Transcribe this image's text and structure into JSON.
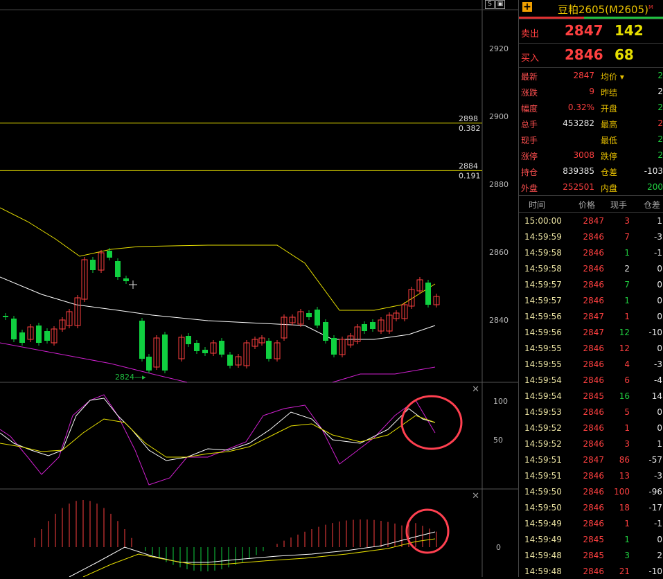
{
  "chart": {
    "toolbar": {
      "s_label": "S",
      "lock_icon": "lock-icon"
    },
    "price_axis": {
      "ticks": [
        "2920",
        "2900",
        "2880",
        "2860",
        "2840"
      ]
    },
    "fib_levels": [
      {
        "price": "2898",
        "ratio": "0.382"
      },
      {
        "price": "2884",
        "ratio": "0.191"
      }
    ],
    "low_annotation": "2824",
    "kdj_axis": {
      "ticks": [
        "100",
        "50"
      ]
    },
    "macd_axis": {
      "ticks": [
        "0"
      ]
    },
    "colors": {
      "up": "#ff4040",
      "down": "#10d040",
      "fib": "#e8e000",
      "boll_mid": "#ffffff",
      "boll_up": "#e8e000",
      "boll_low": "#d020d0",
      "highlight": "#ff4050"
    }
  },
  "side": {
    "title": "豆粕2605(M2605)",
    "title_mark": "M",
    "sell_label": "卖出",
    "sell_price": "2847",
    "sell_vol": "142",
    "buy_label": "买入",
    "buy_price": "2846",
    "buy_vol": "68",
    "quotes": [
      {
        "k1": "最新",
        "v1": "2847",
        "c1": "#ff4040",
        "k2": "均价 ▾",
        "v2": "2",
        "c2": "#20d040"
      },
      {
        "k1": "涨跌",
        "v1": "9",
        "c1": "#ff4040",
        "k2": "昨结",
        "v2": "2",
        "c2": "#ffffff"
      },
      {
        "k1": "幅度",
        "v1": "0.32%",
        "c1": "#ff4040",
        "k2": "开盘",
        "v2": "2",
        "c2": "#20d040"
      },
      {
        "k1": "总手",
        "v1": "453282",
        "c1": "#e8e8e8",
        "k2": "最高",
        "v2": "2",
        "c2": "#ff4040"
      },
      {
        "k1": "现手",
        "v1": "",
        "c1": "#e8e8e8",
        "k2": "最低",
        "v2": "2",
        "c2": "#20d040"
      },
      {
        "k1": "涨停",
        "v1": "3008",
        "c1": "#ff4040",
        "k2": "跌停",
        "v2": "2",
        "c2": "#20d040"
      },
      {
        "k1": "持仓",
        "v1": "839385",
        "c1": "#e8e8e8",
        "k2": "仓差",
        "v2": "-103",
        "c2": "#e8e8e8"
      },
      {
        "k1": "外盘",
        "v1": "252501",
        "c1": "#ff4040",
        "k2": "内盘",
        "v2": "200",
        "c2": "#20d040"
      }
    ],
    "ticks_header": {
      "time": "时间",
      "price": "价格",
      "vol": "现手",
      "oi": "仓差"
    },
    "ticks": [
      {
        "time": "15:00:00",
        "price": "2847",
        "vol": "3",
        "oi": "1",
        "pc": "#ff4040",
        "vc": "#ff4040"
      },
      {
        "time": "14:59:59",
        "price": "2846",
        "vol": "7",
        "oi": "-3",
        "pc": "#ff4040",
        "vc": "#ff4040"
      },
      {
        "time": "14:59:58",
        "price": "2846",
        "vol": "1",
        "oi": "-1",
        "pc": "#ff4040",
        "vc": "#20d040"
      },
      {
        "time": "14:59:58",
        "price": "2846",
        "vol": "2",
        "oi": "0",
        "pc": "#ff4040",
        "vc": "#e8e8e8"
      },
      {
        "time": "14:59:57",
        "price": "2846",
        "vol": "7",
        "oi": "0",
        "pc": "#ff4040",
        "vc": "#20d040"
      },
      {
        "time": "14:59:57",
        "price": "2846",
        "vol": "1",
        "oi": "0",
        "pc": "#ff4040",
        "vc": "#20d040"
      },
      {
        "time": "14:59:56",
        "price": "2847",
        "vol": "1",
        "oi": "0",
        "pc": "#ff4040",
        "vc": "#ff4040"
      },
      {
        "time": "14:59:56",
        "price": "2847",
        "vol": "12",
        "oi": "-10",
        "pc": "#ff4040",
        "vc": "#20d040"
      },
      {
        "time": "14:59:55",
        "price": "2846",
        "vol": "12",
        "oi": "0",
        "pc": "#ff4040",
        "vc": "#ff4040"
      },
      {
        "time": "14:59:55",
        "price": "2846",
        "vol": "4",
        "oi": "-3",
        "pc": "#ff4040",
        "vc": "#ff4040"
      },
      {
        "time": "14:59:54",
        "price": "2846",
        "vol": "6",
        "oi": "-4",
        "pc": "#ff4040",
        "vc": "#ff4040"
      },
      {
        "time": "14:59:54",
        "price": "2845",
        "vol": "16",
        "oi": "14",
        "pc": "#ff4040",
        "vc": "#20d040"
      },
      {
        "time": "14:59:53",
        "price": "2846",
        "vol": "5",
        "oi": "0",
        "pc": "#ff4040",
        "vc": "#ff4040"
      },
      {
        "time": "14:59:52",
        "price": "2846",
        "vol": "1",
        "oi": "0",
        "pc": "#ff4040",
        "vc": "#ff4040"
      },
      {
        "time": "14:59:52",
        "price": "2846",
        "vol": "3",
        "oi": "1",
        "pc": "#ff4040",
        "vc": "#ff4040"
      },
      {
        "time": "14:59:51",
        "price": "2847",
        "vol": "86",
        "oi": "-57",
        "pc": "#ff4040",
        "vc": "#ff4040"
      },
      {
        "time": "14:59:51",
        "price": "2846",
        "vol": "13",
        "oi": "-3",
        "pc": "#ff4040",
        "vc": "#ff4040"
      },
      {
        "time": "14:59:50",
        "price": "2846",
        "vol": "100",
        "oi": "-96",
        "pc": "#ff4040",
        "vc": "#ff4040"
      },
      {
        "time": "14:59:50",
        "price": "2846",
        "vol": "18",
        "oi": "-17",
        "pc": "#ff4040",
        "vc": "#ff4040"
      },
      {
        "time": "14:59:49",
        "price": "2846",
        "vol": "1",
        "oi": "-1",
        "pc": "#ff4040",
        "vc": "#ff4040"
      },
      {
        "time": "14:59:49",
        "price": "2845",
        "vol": "1",
        "oi": "0",
        "pc": "#ff4040",
        "vc": "#20d040"
      },
      {
        "time": "14:59:48",
        "price": "2845",
        "vol": "3",
        "oi": "2",
        "pc": "#ff4040",
        "vc": "#20d040"
      },
      {
        "time": "14:59:48",
        "price": "2846",
        "vol": "21",
        "oi": "-10",
        "pc": "#ff4040",
        "vc": "#ff4040"
      }
    ]
  }
}
